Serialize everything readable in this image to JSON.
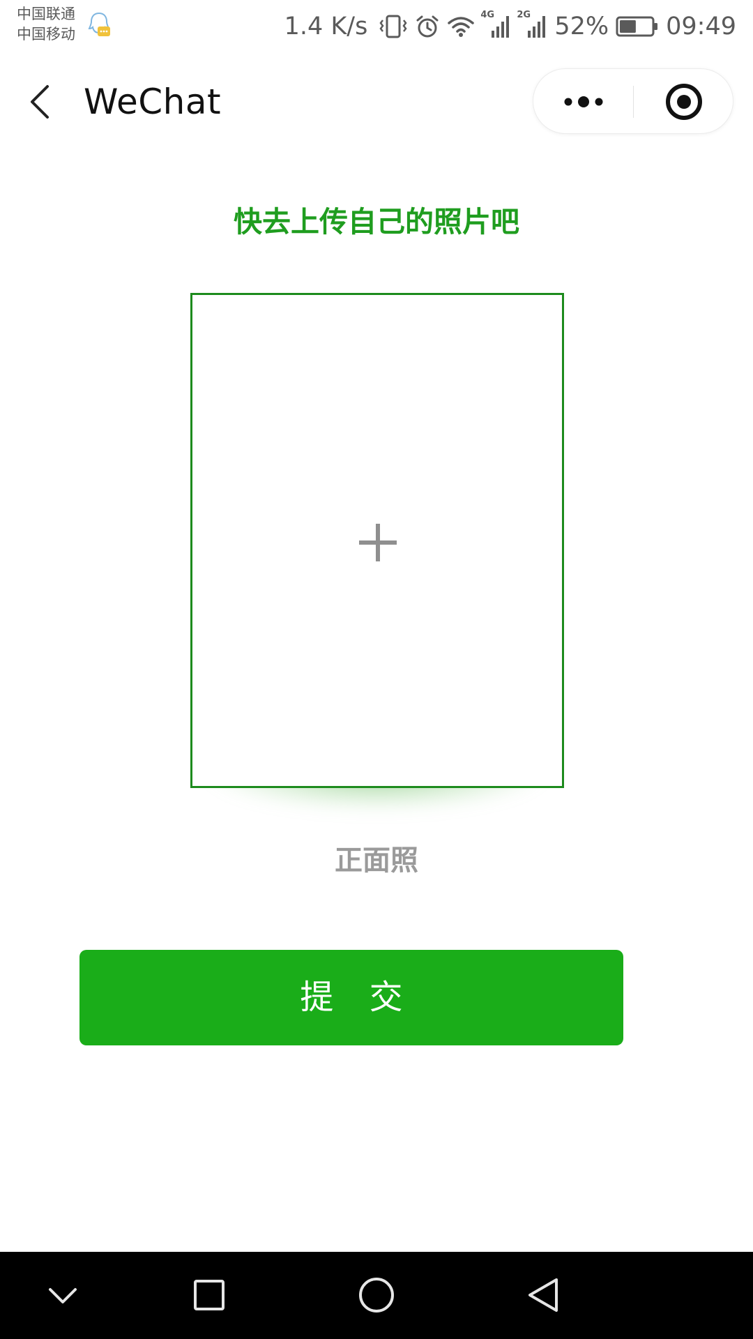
{
  "status_bar": {
    "carrier_1": "中国联通",
    "carrier_2": "中国移动",
    "net_speed": "1.4 K/s",
    "signal_1_tag": "4G",
    "signal_2_tag": "2G",
    "battery": "52%",
    "time": "09:49",
    "battery_level": 0.52,
    "icons": [
      "qq-notification-icon",
      "vibrate-icon",
      "alarm-icon",
      "wifi-icon",
      "signal-4g-icon",
      "signal-2g-icon",
      "battery-icon"
    ]
  },
  "nav": {
    "title": "WeChat",
    "back_icon": "chevron-left-icon",
    "more_icon": "more-dots-icon",
    "close_icon": "target-close-icon"
  },
  "content": {
    "prompt": "快去上传自己的照片吧",
    "upload_icon": "plus-icon",
    "photo_label": "正面照",
    "submit_label": "提 交"
  },
  "system_nav": {
    "buttons": [
      "chevron-down-icon",
      "square-icon",
      "circle-icon",
      "triangle-back-icon"
    ]
  },
  "colors": {
    "accent_green": "#1aad19",
    "prompt_green": "#1f9d1f",
    "border_green": "#1d8b1d",
    "status_gray": "#5a5a5a"
  }
}
